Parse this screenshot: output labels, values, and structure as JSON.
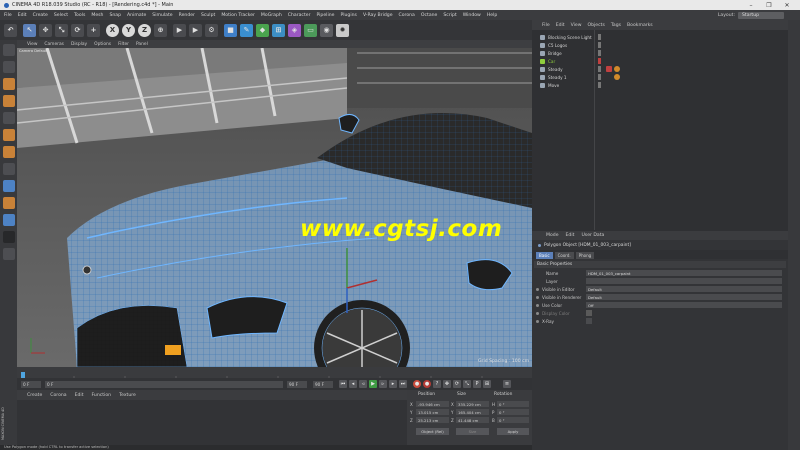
{
  "window": {
    "title": "CINEMA 4D R18.039 Studio (RC - R18) - [Rendering.c4d *] - Main",
    "controls": [
      "–",
      "❐",
      "✕"
    ]
  },
  "menubar": [
    "File",
    "Edit",
    "Create",
    "Select",
    "Tools",
    "Mesh",
    "Snap",
    "Animate",
    "Simulate",
    "Render",
    "Sculpt",
    "Motion Tracker",
    "MoGraph",
    "Character",
    "Pipeline",
    "Plugins",
    "V-Ray Bridge",
    "Corona",
    "Octane",
    "Script",
    "Window",
    "Help"
  ],
  "layout": {
    "label": "Layout:",
    "value": "Startup"
  },
  "toolbar": {
    "axis_x": "X",
    "axis_y": "Y",
    "axis_z": "Z"
  },
  "viewport": {
    "menu": [
      "View",
      "Cameras",
      "Display",
      "Options",
      "Filter",
      "Panel"
    ],
    "camera_label": "Camera Default",
    "watermark": "www.cgtsj.com",
    "grid_spacing": "Grid Spacing : 100 cm"
  },
  "timeline": {
    "start": "0 F",
    "current": "0 F",
    "end": "90 F",
    "end2": "90 F"
  },
  "material_manager": {
    "menu": [
      "Create",
      "Corona",
      "Edit",
      "Function",
      "Texture"
    ],
    "side_logo": "MAXON CINEMA 4D"
  },
  "status": "Use Polygon mode (hold CTRL to transfer active selection)",
  "coordinates": {
    "headers": [
      "Position",
      "Size",
      "Rotation"
    ],
    "rows": [
      {
        "axis": "X",
        "pos": "-93.946 cm",
        "size": "335.229 cm",
        "rot_label": "H",
        "rot": "0 °"
      },
      {
        "axis": "Y",
        "pos": "13.015 cm",
        "size": "165.404 cm",
        "rot_label": "P",
        "rot": "0 °"
      },
      {
        "axis": "Z",
        "pos": "25.213 cm",
        "size": "41.448 cm",
        "rot_label": "B",
        "rot": "0 °"
      }
    ],
    "mode": "Object (Rel)",
    "size_mode": "Size",
    "apply": "Apply"
  },
  "object_manager": {
    "menu": [
      "File",
      "Edit",
      "View",
      "Objects",
      "Tags",
      "Bookmarks"
    ],
    "objects": [
      {
        "name": "Blocking Scene Light",
        "color": "#9aa6b4"
      },
      {
        "name": "C5 Logos",
        "color": "#9aa6b4"
      },
      {
        "name": "Bridge",
        "color": "#9aa6b4"
      },
      {
        "name": "Car",
        "color": "#8fce3d"
      },
      {
        "name": "Steady",
        "color": "#9aa6b4"
      },
      {
        "name": "Steady 1",
        "color": "#9aa6b4"
      },
      {
        "name": "Move",
        "color": "#9aa6b4"
      }
    ]
  },
  "attribute_manager": {
    "menu": [
      "Mode",
      "Edit",
      "User Data"
    ],
    "title": "Polygon Object [HDM_01_003_carpaint]",
    "tabs": [
      "Basic",
      "Coord.",
      "Phong"
    ],
    "section": "Basic Properties",
    "props": [
      {
        "label": "Name",
        "value": "HDM_01_003_carpaint"
      },
      {
        "label": "Layer",
        "value": ""
      },
      {
        "label": "Visible in Editor",
        "value": "Default"
      },
      {
        "label": "Visible in Renderer",
        "value": "Default"
      },
      {
        "label": "Use Color",
        "value": "Off"
      },
      {
        "label": "Display Color",
        "value": ""
      },
      {
        "label": "X-Ray",
        "value": ""
      }
    ]
  },
  "colors": {
    "accent": "#5b7fb8",
    "watermark": "#ffff00",
    "wireframe": "#6fb6ff",
    "car_icon": "#8fce3d"
  }
}
